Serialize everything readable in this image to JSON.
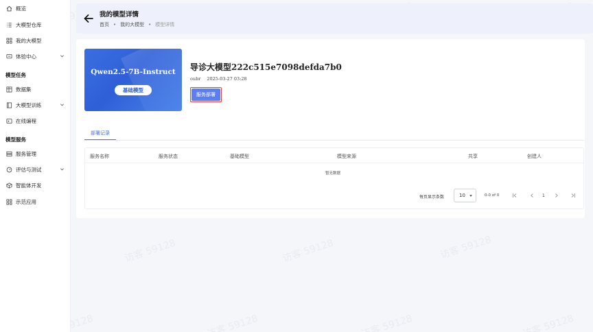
{
  "sidebar": {
    "items": [
      {
        "label": "概览",
        "icon": "home-icon"
      },
      {
        "label": "大模型仓库",
        "icon": "grid-list-icon"
      },
      {
        "label": "我的大模型",
        "icon": "apps-icon"
      },
      {
        "label": "体验中心",
        "icon": "chat-icon"
      },
      {
        "label": "数据集",
        "icon": "table-icon"
      },
      {
        "label": "大模型训练",
        "icon": "book-icon"
      },
      {
        "label": "在线编程",
        "icon": "code-icon"
      },
      {
        "label": "服务管理",
        "icon": "server-icon"
      },
      {
        "label": "评估与测试",
        "icon": "gauge-icon"
      },
      {
        "label": "智能体开发",
        "icon": "cube-icon"
      },
      {
        "label": "示范应用",
        "icon": "apps-icon"
      }
    ],
    "sections": {
      "model_tasks": "模型任务",
      "model_services": "模型服务"
    }
  },
  "header": {
    "title": "我的模型详情",
    "breadcrumb": [
      "首页",
      "我的大模型",
      "模型详情"
    ]
  },
  "model": {
    "banner_name": "Qwen2.5-7B-Instruct",
    "banner_badge": "基础模型",
    "title": "导诊大模型222c515e7098defda7b0",
    "owner": "oubr",
    "created": "2025-03-27 03:28",
    "deploy_label": "服务部署"
  },
  "tabs": {
    "active": "部署记录"
  },
  "table": {
    "columns": [
      "服务名称",
      "服务状态",
      "基础模型",
      "模型来源",
      "共享",
      "创建人"
    ],
    "empty_text": "暂无数据"
  },
  "pagination": {
    "per_page_label": "每页显示条数",
    "per_page_value": "10",
    "range_text": "0-0 of 0",
    "page": "1"
  },
  "watermark": "访客 59128",
  "colors": {
    "accent": "#4b6fe3",
    "banner": "#2f5fd8",
    "highlight": "#e53935"
  }
}
